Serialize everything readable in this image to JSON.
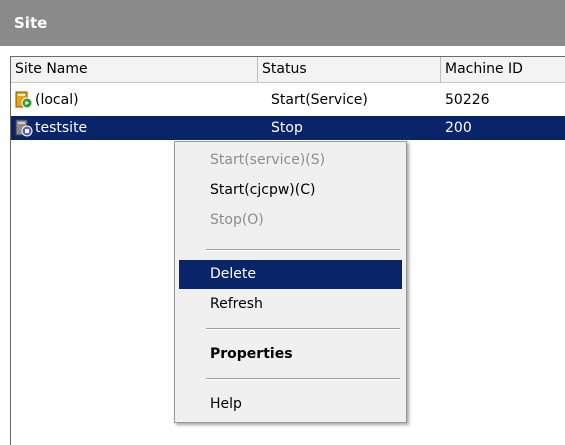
{
  "panel": {
    "title": "Site"
  },
  "columns": [
    {
      "label": "Site Name"
    },
    {
      "label": "Status"
    },
    {
      "label": "Machine ID"
    }
  ],
  "rows": [
    {
      "name": "(local)",
      "status": "Start(Service)",
      "machine_id": "50226",
      "icon": "site-running-icon",
      "selected": false
    },
    {
      "name": "testsite",
      "status": "Stop",
      "machine_id": "200",
      "icon": "site-stopped-icon",
      "selected": true
    }
  ],
  "context_menu": {
    "items": [
      {
        "label": "Start(service)(S)",
        "enabled": false
      },
      {
        "label": "Start(cjcpw)(C)",
        "enabled": true
      },
      {
        "label": "Stop(O)",
        "enabled": false
      },
      {
        "label": "Delete",
        "enabled": true,
        "highlighted": true
      },
      {
        "label": "Refresh",
        "enabled": true
      },
      {
        "label": "Properties",
        "enabled": true,
        "bold": true
      },
      {
        "label": "Help",
        "enabled": true
      }
    ]
  },
  "colors": {
    "title_bar": "#8a8a8a",
    "selection": "#0a246a",
    "menu_background": "#f0f0f0",
    "disabled_text": "#8d8d8d"
  }
}
